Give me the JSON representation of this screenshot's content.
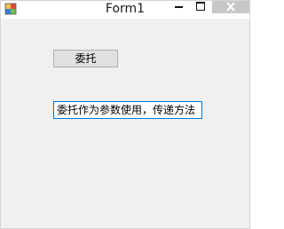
{
  "window": {
    "title": "Form1",
    "icon": "winforms-app-icon",
    "controls": {
      "minimize_icon": "minimize-icon",
      "maximize_icon": "maximize-icon",
      "close_icon": "close-icon"
    }
  },
  "form": {
    "button_label": "委托",
    "textbox_value": "委托作为参数使用，传递方法"
  },
  "colors": {
    "close_button_bg": "#c7c7c7",
    "textbox_border": "#0078d7",
    "form_bg": "#f0f0f0"
  }
}
